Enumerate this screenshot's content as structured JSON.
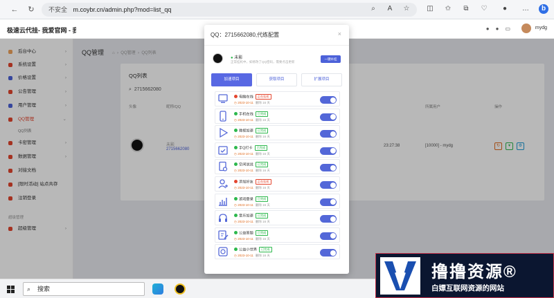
{
  "browser": {
    "security": "不安全",
    "url": "m.coybr.cn/admin.php?mod=list_qq",
    "profile_initial": "b"
  },
  "header": {
    "brand": "极速云代挂- 我爱官网 - 我",
    "user": "mydg"
  },
  "sidebar": {
    "items": [
      {
        "label": "后台中心",
        "icon": "home-icon",
        "color": "#f0a45d",
        "arrow": "›"
      },
      {
        "label": "系统设置",
        "icon": "gear-icon",
        "color": "#e4462f",
        "arrow": "›"
      },
      {
        "label": "价格设置",
        "icon": "flag-icon",
        "color": "#4c61d9",
        "arrow": "›"
      },
      {
        "label": "公告管理",
        "icon": "bell-icon",
        "color": "#e4462f",
        "arrow": "›"
      },
      {
        "label": "用户管理",
        "icon": "user-icon",
        "color": "#4c61d9",
        "arrow": "›"
      },
      {
        "label": "QQ管理",
        "icon": "qq-icon",
        "color": "#e4462f",
        "arrow": "⌄"
      },
      {
        "label": "卡密管理",
        "icon": "card-icon",
        "color": "#e4462f",
        "arrow": "›"
      },
      {
        "label": "数据管理",
        "icon": "data-icon",
        "color": "#e4462f",
        "arrow": "›"
      },
      {
        "label": "对接文档",
        "icon": "doc-icon",
        "color": "#e4462f",
        "arrow": ""
      },
      {
        "label": "[限时活动] 站点共存",
        "icon": "gift-icon",
        "color": "#e4462f",
        "arrow": ""
      },
      {
        "label": "注销登录",
        "icon": "logout-icon",
        "color": "#e4462f",
        "arrow": ""
      },
      {
        "label": "超级管理",
        "icon": "shield-icon",
        "color": "#e4462f",
        "arrow": "›"
      }
    ],
    "sub_item": "QQ列表",
    "group_label": "超级管理"
  },
  "main": {
    "page_title": "QQ管理",
    "breadcrumb": [
      "QQ管理",
      "QQ列表"
    ],
    "card_title": "QQ列表",
    "search_value": "2715662080",
    "columns": [
      "头像",
      "昵称/QQ",
      "所属用户",
      "操作"
    ],
    "row": {
      "nick": "未影",
      "qq": "2715662080",
      "time": "23:27:38",
      "owner": "[10000] - mydg"
    }
  },
  "modal": {
    "title": "QQ：2715662080,代练配置",
    "close": "×",
    "user_name": "未影",
    "user_desc": "正常挂机中，如修改了QQ密码，需要点击更新",
    "update_button": "一键补挂",
    "tabs": [
      "加速项目",
      "获取项目",
      "扩展项目"
    ],
    "tasks": [
      {
        "name": "电脑在线",
        "status": "正在挂机",
        "status_color": "#e4462f",
        "dot": "#e4462f",
        "date": "2023-10-11",
        "rest": "删除 16 天",
        "icon": "computer-icon"
      },
      {
        "name": "手机在线",
        "status": "已完成",
        "status_color": "#2db84d",
        "dot": "#2db84d",
        "date": "2023-10-11",
        "rest": "删除 16 天",
        "icon": "phone-icon"
      },
      {
        "name": "微视加速",
        "status": "已完成",
        "status_color": "#2db84d",
        "dot": "#2db84d",
        "date": "2023-10-11",
        "rest": "删除 16 天",
        "icon": "play-icon"
      },
      {
        "name": "手Q打卡",
        "status": "已完成",
        "status_color": "#2db84d",
        "dot": "#2db84d",
        "date": "2023-10-11",
        "rest": "删除 16 天",
        "icon": "calendar-check-icon"
      },
      {
        "name": "空间说说",
        "status": "已完成",
        "status_color": "#2db84d",
        "dot": "#2db84d",
        "date": "2023-10-11",
        "rest": "删除 16 天",
        "icon": "doc-search-icon"
      },
      {
        "name": "添加好友",
        "status": "正在挂机",
        "status_color": "#e4462f",
        "dot": "#e4462f",
        "date": "2023-10-11",
        "rest": "删除 16 天",
        "icon": "add-user-icon"
      },
      {
        "name": "游戏登录",
        "status": "已完成",
        "status_color": "#2db84d",
        "dot": "#2db84d",
        "date": "2023-10-11",
        "rest": "删除 16 天",
        "icon": "chart-icon"
      },
      {
        "name": "音乐加速",
        "status": "已完成",
        "status_color": "#2db84d",
        "dot": "#2db84d",
        "date": "2023-10-11",
        "rest": "删除 16 天",
        "icon": "headphones-icon"
      },
      {
        "name": "公益答题",
        "status": "已完成",
        "status_color": "#2db84d",
        "dot": "#2db84d",
        "date": "2023-10-11",
        "rest": "删除 16 天",
        "icon": "edit-doc-icon"
      },
      {
        "name": "公益小世界",
        "status": "已完成",
        "status_color": "#2db84d",
        "dot": "#2db84d",
        "date": "2023-10-11",
        "rest": "删除 16 天",
        "icon": "world-icon"
      }
    ]
  },
  "taskbar": {
    "search_placeholder": "搜索"
  },
  "watermark": {
    "title": "撸撸资源®",
    "subtitle": "白嫖互联网资源的网站"
  },
  "colors": {
    "accent": "#5868e3",
    "danger": "#e4462f",
    "success": "#2db84d"
  }
}
